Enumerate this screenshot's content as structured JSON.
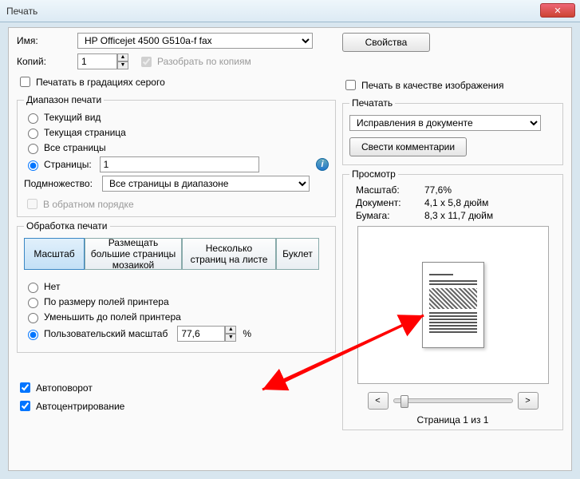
{
  "window": {
    "title": "Печать"
  },
  "top": {
    "nameLabel": "Имя:",
    "printerSelected": "HP Officejet 4500 G510a-f fax",
    "propertiesBtn": "Свойства",
    "copiesLabel": "Копий:",
    "copiesValue": "1",
    "collate": "Разобрать по копиям",
    "grayscale": "Печатать в градациях серого",
    "asImage": "Печать в качестве изображения"
  },
  "range": {
    "legend": "Диапазон печати",
    "currentView": "Текущий вид",
    "currentPage": "Текущая страница",
    "allPages": "Все страницы",
    "pages": "Страницы:",
    "pagesValue": "1",
    "subsetLabel": "Подмножество:",
    "subsetSelected": "Все страницы в диапазоне",
    "reverse": "В обратном порядке"
  },
  "handle": {
    "legend": "Обработка печати",
    "tabScale": "Масштаб",
    "tabTile": "Размещать большие страницы мозаикой",
    "tabMulti": "Несколько страниц на листе",
    "tabBooklet": "Буклет",
    "optNone": "Нет",
    "optFit": "По размеру полей принтера",
    "optShrink": "Уменьшить до полей принтера",
    "optCustom": "Пользовательский масштаб",
    "customValue": "77,6",
    "percent": "%"
  },
  "footer": {
    "autorotate": "Автоповорот",
    "autocenter": "Автоцентрирование"
  },
  "printwhat": {
    "legend": "Печатать",
    "selected": "Исправления в документе",
    "flattenBtn": "Свести комментарии"
  },
  "preview": {
    "legend": "Просмотр",
    "zoomK": "Масштаб:",
    "zoomV": "77,6%",
    "docK": "Документ:",
    "docV": "4,1 x 5,8 дюйм",
    "paperK": "Бумага:",
    "paperV": "8,3 x 11,7 дюйм",
    "pageNof": "Страница 1 из 1",
    "prev": "<",
    "next": ">"
  }
}
